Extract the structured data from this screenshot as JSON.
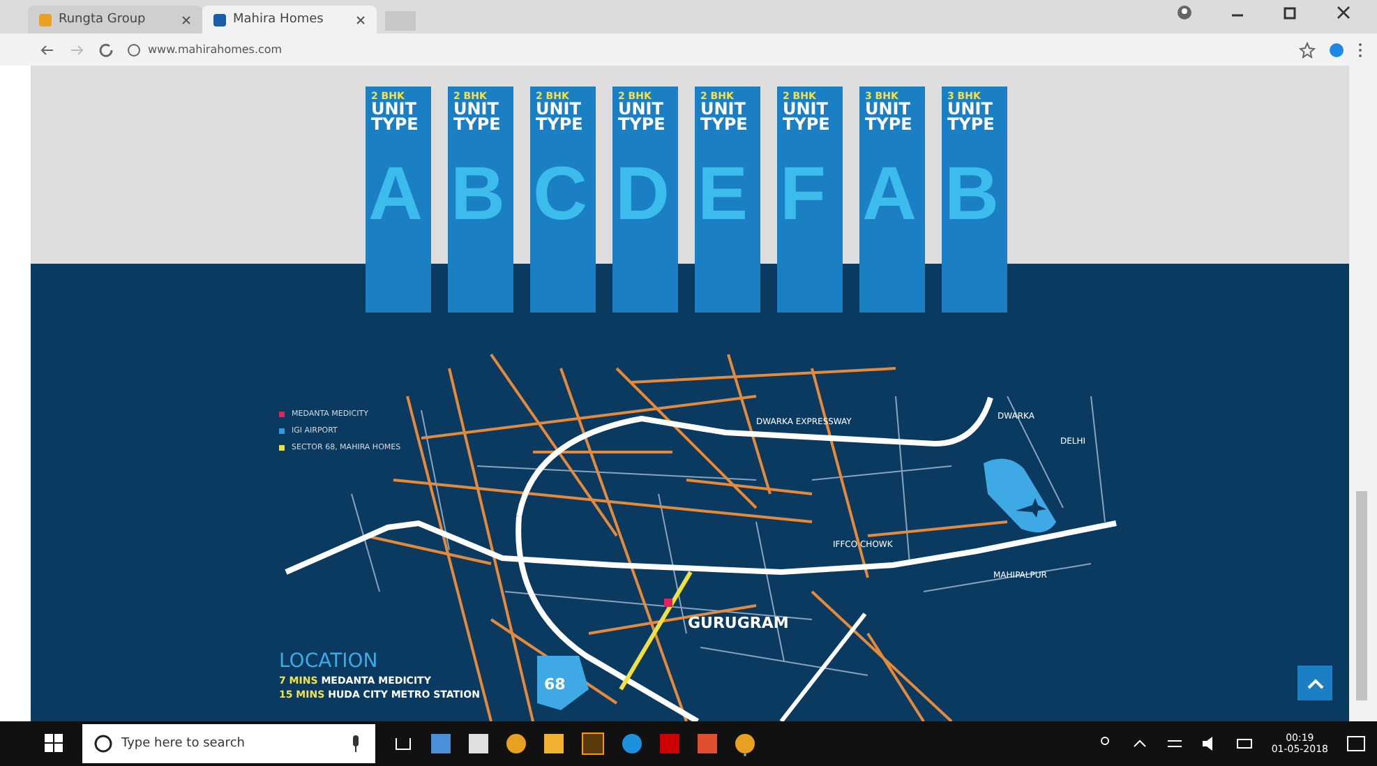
{
  "browser": {
    "tabs": [
      {
        "title": "Rungta Group",
        "selected": false
      },
      {
        "title": "Mahira Homes",
        "selected": true
      }
    ],
    "address": "www.mahirahomes.com"
  },
  "units": [
    {
      "bhk": "2 BHK",
      "label": "UNIT TYPE",
      "letter": "A"
    },
    {
      "bhk": "2 BHK",
      "label": "UNIT TYPE",
      "letter": "B"
    },
    {
      "bhk": "2 BHK",
      "label": "UNIT TYPE",
      "letter": "C"
    },
    {
      "bhk": "2 BHK",
      "label": "UNIT TYPE",
      "letter": "D"
    },
    {
      "bhk": "2 BHK",
      "label": "UNIT TYPE",
      "letter": "E"
    },
    {
      "bhk": "2 BHK",
      "label": "UNIT TYPE",
      "letter": "F"
    },
    {
      "bhk": "3 BHK",
      "label": "UNIT TYPE",
      "letter": "A"
    },
    {
      "bhk": "3 BHK",
      "label": "UNIT TYPE",
      "letter": "B"
    }
  ],
  "legend": [
    {
      "label": "MEDANTA MEDICITY",
      "color": "#e0245e"
    },
    {
      "label": "IGI AIRPORT",
      "color": "#2f9be0"
    },
    {
      "label": "SECTOR 68, MAHIRA HOMES",
      "color": "#e8e23a"
    }
  ],
  "map_labels": {
    "city": "GURUGRAM",
    "sector": "68",
    "places": [
      {
        "text": "DWARKA EXPRESSWAY"
      },
      {
        "text": "DWARKA"
      },
      {
        "text": "DELHI"
      },
      {
        "text": "IFFCO CHOWK"
      },
      {
        "text": "MAHIPALPUR"
      }
    ]
  },
  "location": {
    "title": "LOCATION",
    "items": [
      {
        "time": "7 MINS",
        "place": "MEDANTA MEDICITY"
      },
      {
        "time": "15 MINS",
        "place": "HUDA CITY METRO STATION"
      }
    ]
  },
  "taskbar": {
    "search_placeholder": "Type here to search",
    "time": "00:19",
    "date": "01-05-2018"
  }
}
